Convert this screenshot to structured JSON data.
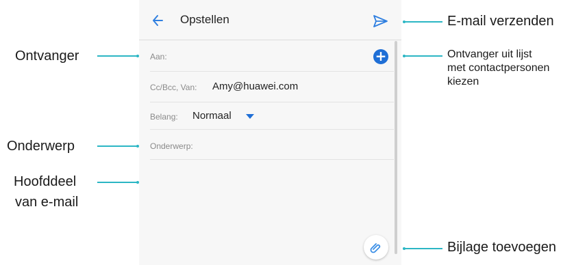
{
  "header": {
    "title": "Opstellen"
  },
  "fields": {
    "to_label": "Aan:",
    "cc_label": "Cc/Bcc, Van:",
    "cc_value": "Amy@huawei.com",
    "priority_label": "Belang:",
    "priority_value": "Normaal",
    "subject_label": "Onderwerp:"
  },
  "icons": {
    "back": "back-arrow-icon",
    "send": "send-icon",
    "add_recipient": "plus-circle-icon",
    "dropdown": "chevron-down-icon",
    "attach": "paperclip-icon"
  },
  "callouts": {
    "recipient": "Ontvanger",
    "subject": "Onderwerp",
    "body_line1": "Hoofddeel",
    "body_line2": "van e-mail",
    "send": "E-mail verzenden",
    "contacts_line1": "Ontvanger uit lijst",
    "contacts_line2": "met contactpersonen",
    "contacts_line3": "kiezen",
    "attach": "Bijlage toevoegen"
  },
  "colors": {
    "accent": "#1f6fd6",
    "callout_line": "#2bb6c4"
  }
}
